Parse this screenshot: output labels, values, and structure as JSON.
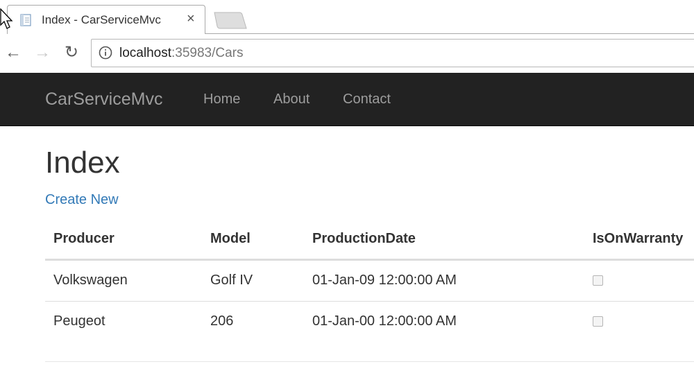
{
  "browser": {
    "tab": {
      "title": "Index - CarServiceMvc",
      "close": "×"
    },
    "nav": {
      "back": "←",
      "forward": "→",
      "reload": "↻"
    },
    "url": {
      "host": "localhost",
      "rest": ":35983/Cars"
    }
  },
  "navbar": {
    "brand": "CarServiceMvc",
    "links": [
      "Home",
      "About",
      "Contact"
    ]
  },
  "page": {
    "title": "Index",
    "create_link": "Create New"
  },
  "table": {
    "headers": [
      "Producer",
      "Model",
      "ProductionDate",
      "IsOnWarranty"
    ],
    "rows": [
      {
        "producer": "Volkswagen",
        "model": "Golf IV",
        "production_date": "01-Jan-09 12:00:00 AM",
        "is_on_warranty": false
      },
      {
        "producer": "Peugeot",
        "model": "206",
        "production_date": "01-Jan-00 12:00:00 AM",
        "is_on_warranty": false
      }
    ]
  },
  "colors": {
    "navbar_bg": "#222222",
    "navbar_text": "#9d9d9d",
    "link": "#337ab7"
  }
}
